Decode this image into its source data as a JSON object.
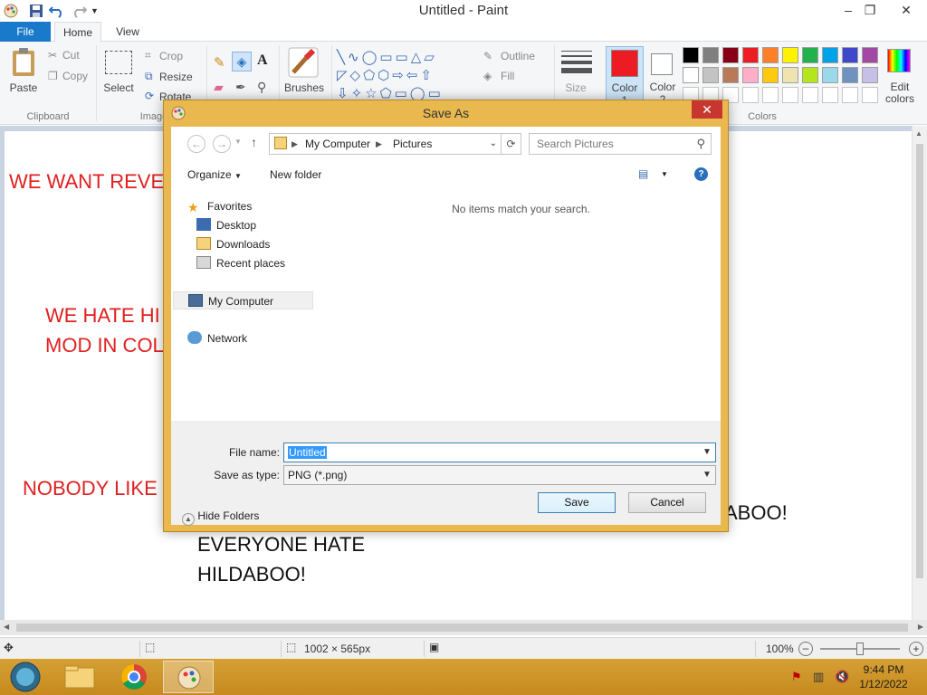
{
  "window": {
    "title": "Untitled - Paint"
  },
  "tabs": [
    "File",
    "Home",
    "View"
  ],
  "ribbon": {
    "clipboard": {
      "paste": "Paste",
      "cut": "Cut",
      "copy": "Copy",
      "group": "Clipboard"
    },
    "image": {
      "select": "Select",
      "crop": "Crop",
      "resize": "Resize",
      "rotate": "Rotate",
      "group": "Image"
    },
    "brushes": "Brushes",
    "shapes": {
      "outline": "Outline",
      "fill": "Fill"
    },
    "size": "Size",
    "color1": {
      "label": "Color",
      "num": "1",
      "value": "#ed1c24"
    },
    "color2": {
      "label": "Color",
      "num": "2",
      "value": "#ffffff"
    },
    "colors_group": "Colors",
    "edit_colors": {
      "line1": "Edit",
      "line2": "colors"
    },
    "palette_row1": [
      "#000000",
      "#7f7f7f",
      "#880015",
      "#ed1c24",
      "#ff7f27",
      "#fff200",
      "#22b14c",
      "#00a2e8",
      "#3f48cc",
      "#a349a4"
    ],
    "palette_row2": [
      "#ffffff",
      "#c3c3c3",
      "#b97a57",
      "#ffaec9",
      "#ffc90e",
      "#efe4b0",
      "#b5e61d",
      "#99d9ea",
      "#7092be",
      "#c8bfe7"
    ]
  },
  "canvas_text": {
    "line1": "WE WANT REVE",
    "line2a": "WE HATE HI",
    "line2b": "MOD IN COL",
    "line3": "NOBODY LIKE",
    "line4": "ABOO!",
    "line5a": "EVERYONE HATE",
    "line5b": "HILDABOO!"
  },
  "statusbar": {
    "dimensions": "1002 × 565px",
    "zoom": "100%"
  },
  "taskbar": {
    "time": "9:44 PM",
    "date": "1/12/2022"
  },
  "dialog": {
    "title": "Save As",
    "breadcrumb": [
      "My Computer",
      "Pictures"
    ],
    "search_placeholder": "Search Pictures",
    "organize": "Organize",
    "new_folder": "New folder",
    "nav": {
      "favorites": "Favorites",
      "desktop": "Desktop",
      "downloads": "Downloads",
      "recent": "Recent places",
      "computer": "My Computer",
      "network": "Network"
    },
    "empty_message": "No items match your search.",
    "file_name_label": "File name:",
    "file_name_value": "Untitled",
    "save_type_label": "Save as type:",
    "save_type_value": "PNG (*.png)",
    "hide_folders": "Hide Folders",
    "save": "Save",
    "cancel": "Cancel"
  }
}
